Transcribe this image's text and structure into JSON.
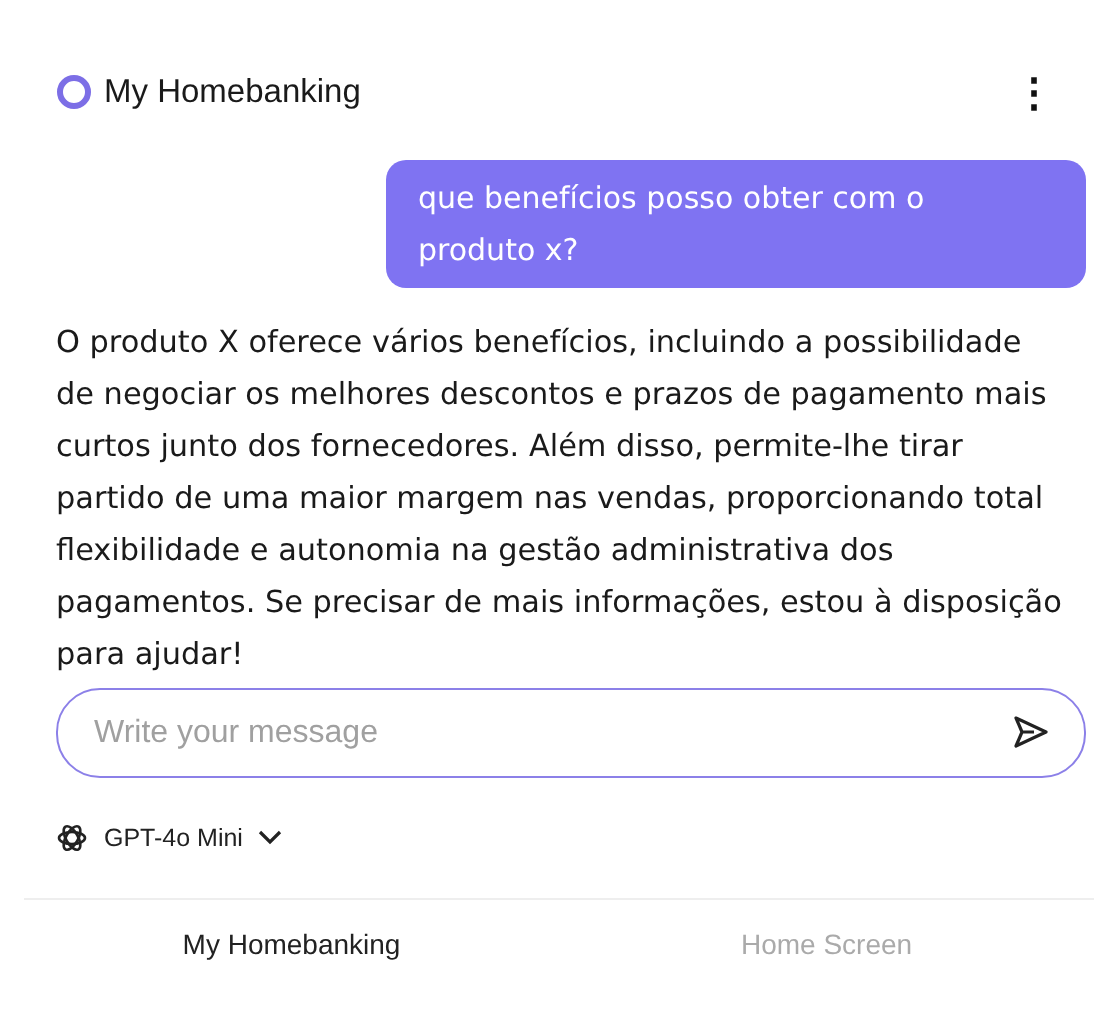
{
  "header": {
    "title": "My Homebanking",
    "menu": "⋮"
  },
  "messages": [
    {
      "kind": "user",
      "text": "que benefícios posso obter com o produto x?"
    },
    {
      "kind": "assistant",
      "text": "O produto X oferece vários benefícios, incluindo a possibilidade de negociar os melhores descontos e prazos de pagamento mais curtos junto dos fornecedores. Além disso, permite-lhe tirar partido de uma maior margem nas vendas, proporcionando total flexibilidade e autonomia na gestão administrativa dos pagamentos. Se precisar de mais informações, estou à disposição para ajudar!"
    }
  ],
  "composer": {
    "placeholder": "Write your message"
  },
  "model": {
    "label": "GPT-4o Mini"
  },
  "tabs": [
    {
      "label": "My Homebanking",
      "selected": true
    },
    {
      "label": "Home Screen",
      "selected": false
    }
  ]
}
